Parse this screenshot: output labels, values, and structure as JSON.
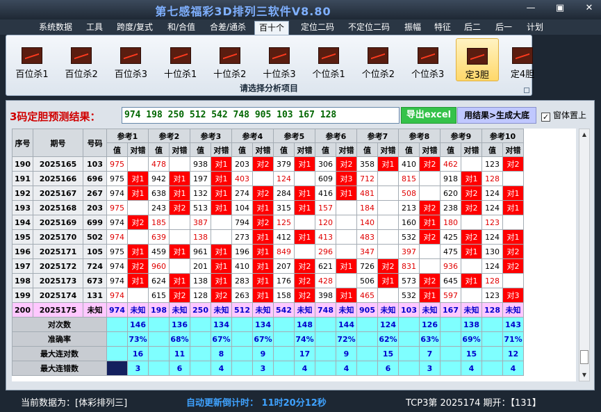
{
  "window": {
    "title": "第七感福彩3D排列三软件V8.80",
    "minimize": "—",
    "restore": "▣",
    "close": "✕"
  },
  "menu": [
    "系统数据",
    "工具",
    "跨度/复式",
    "和/合值",
    "合差/通杀",
    "百十个",
    "定位二码",
    "不定位二码",
    "振幅",
    "特征",
    "后二",
    "后一",
    "计划"
  ],
  "menu_active": "百十个",
  "ribbon": {
    "items": [
      "百位杀1",
      "百位杀2",
      "百位杀3",
      "十位杀1",
      "十位杀2",
      "十位杀3",
      "个位杀1",
      "个位杀2",
      "个位杀3",
      "定3胆",
      "定4胆"
    ],
    "active": "定3胆",
    "footer": "请选择分析项目"
  },
  "prediction": {
    "label": "3码定胆预测结果：",
    "value": "974 198 250 512 542 748 905 103 167 128",
    "export_button": "导出excel",
    "generate_button": "用结果>生成大底",
    "pin_checkbox": "窗体置上",
    "pin_checked": true
  },
  "table": {
    "headers": {
      "index": "序号",
      "period": "期号",
      "number": "号码",
      "value": "值",
      "result": "对错"
    },
    "refs": [
      "参考1",
      "参考2",
      "参考3",
      "参考4",
      "参考5",
      "参考6",
      "参考7",
      "参考8",
      "参考9",
      "参考10"
    ],
    "rows": [
      {
        "idx": "190",
        "period": "2025165",
        "num": "103",
        "cells": [
          [
            "975",
            "",
            "vred"
          ],
          [
            "478",
            "",
            "vred"
          ],
          [
            "938",
            "对1",
            ""
          ],
          [
            "203",
            "对2",
            ""
          ],
          [
            "379",
            "对1",
            ""
          ],
          [
            "306",
            "对2",
            ""
          ],
          [
            "358",
            "对1",
            ""
          ],
          [
            "410",
            "对2",
            ""
          ],
          [
            "462",
            "",
            "vred"
          ],
          [
            "123",
            "对2",
            ""
          ]
        ]
      },
      {
        "idx": "191",
        "period": "2025166",
        "num": "696",
        "cells": [
          [
            "975",
            "对1",
            ""
          ],
          [
            "942",
            "对1",
            ""
          ],
          [
            "197",
            "对1",
            ""
          ],
          [
            "403",
            "",
            "vred"
          ],
          [
            "124",
            "",
            "vred"
          ],
          [
            "609",
            "对3",
            ""
          ],
          [
            "712",
            "",
            "vred"
          ],
          [
            "815",
            "",
            "vred"
          ],
          [
            "918",
            "对1",
            ""
          ],
          [
            "128",
            "",
            "vred"
          ]
        ]
      },
      {
        "idx": "192",
        "period": "2025167",
        "num": "267",
        "cells": [
          [
            "974",
            "对1",
            ""
          ],
          [
            "638",
            "对1",
            ""
          ],
          [
            "132",
            "对1",
            ""
          ],
          [
            "274",
            "对2",
            ""
          ],
          [
            "284",
            "对1",
            ""
          ],
          [
            "416",
            "对1",
            ""
          ],
          [
            "481",
            "",
            "vred"
          ],
          [
            "508",
            "",
            "vred"
          ],
          [
            "620",
            "对2",
            ""
          ],
          [
            "124",
            "对1",
            ""
          ]
        ]
      },
      {
        "idx": "193",
        "period": "2025168",
        "num": "203",
        "cells": [
          [
            "975",
            "",
            "vred"
          ],
          [
            "243",
            "对2",
            ""
          ],
          [
            "513",
            "对1",
            ""
          ],
          [
            "104",
            "对1",
            ""
          ],
          [
            "315",
            "对1",
            ""
          ],
          [
            "157",
            "",
            "vred"
          ],
          [
            "184",
            "",
            "vred"
          ],
          [
            "213",
            "对2",
            ""
          ],
          [
            "238",
            "对2",
            ""
          ],
          [
            "124",
            "对1",
            ""
          ]
        ]
      },
      {
        "idx": "194",
        "period": "2025169",
        "num": "699",
        "cells": [
          [
            "974",
            "对2",
            ""
          ],
          [
            "185",
            "",
            "vred"
          ],
          [
            "387",
            "",
            "vred"
          ],
          [
            "794",
            "对2",
            ""
          ],
          [
            "125",
            "",
            "vred"
          ],
          [
            "120",
            "",
            "vred"
          ],
          [
            "140",
            "",
            "vred"
          ],
          [
            "160",
            "对1",
            ""
          ],
          [
            "180",
            "",
            "vred"
          ],
          [
            "123",
            "",
            "vred"
          ]
        ]
      },
      {
        "idx": "195",
        "period": "2025170",
        "num": "502",
        "cells": [
          [
            "974",
            "",
            "vred"
          ],
          [
            "639",
            "",
            "vred"
          ],
          [
            "138",
            "",
            "vred"
          ],
          [
            "273",
            "对1",
            ""
          ],
          [
            "412",
            "对1",
            ""
          ],
          [
            "413",
            "",
            "vred"
          ],
          [
            "483",
            "",
            "vred"
          ],
          [
            "532",
            "对2",
            ""
          ],
          [
            "425",
            "对2",
            ""
          ],
          [
            "124",
            "对1",
            ""
          ]
        ]
      },
      {
        "idx": "196",
        "period": "2025171",
        "num": "105",
        "cells": [
          [
            "975",
            "对1",
            ""
          ],
          [
            "459",
            "对1",
            ""
          ],
          [
            "961",
            "对1",
            ""
          ],
          [
            "196",
            "对1",
            ""
          ],
          [
            "849",
            "",
            "vred"
          ],
          [
            "296",
            "",
            "vred"
          ],
          [
            "347",
            "",
            "vred"
          ],
          [
            "397",
            "",
            "vred"
          ],
          [
            "475",
            "对1",
            ""
          ],
          [
            "130",
            "对2",
            ""
          ]
        ]
      },
      {
        "idx": "197",
        "period": "2025172",
        "num": "724",
        "cells": [
          [
            "974",
            "对2",
            ""
          ],
          [
            "960",
            "",
            "vred"
          ],
          [
            "201",
            "对1",
            ""
          ],
          [
            "410",
            "对1",
            ""
          ],
          [
            "207",
            "对2",
            ""
          ],
          [
            "621",
            "对1",
            ""
          ],
          [
            "726",
            "对2",
            ""
          ],
          [
            "831",
            "",
            "vred"
          ],
          [
            "936",
            "",
            "vred"
          ],
          [
            "124",
            "对2",
            ""
          ]
        ]
      },
      {
        "idx": "198",
        "period": "2025173",
        "num": "673",
        "cells": [
          [
            "974",
            "对1",
            ""
          ],
          [
            "624",
            "对1",
            ""
          ],
          [
            "138",
            "对1",
            ""
          ],
          [
            "283",
            "对1",
            ""
          ],
          [
            "176",
            "对2",
            ""
          ],
          [
            "428",
            "",
            "vred"
          ],
          [
            "506",
            "对1",
            ""
          ],
          [
            "573",
            "对2",
            ""
          ],
          [
            "645",
            "对1",
            ""
          ],
          [
            "128",
            "",
            "vred"
          ]
        ]
      },
      {
        "idx": "199",
        "period": "2025174",
        "num": "131",
        "cells": [
          [
            "974",
            "",
            "vred"
          ],
          [
            "615",
            "对2",
            ""
          ],
          [
            "128",
            "对2",
            ""
          ],
          [
            "263",
            "对1",
            ""
          ],
          [
            "158",
            "对2",
            ""
          ],
          [
            "398",
            "对1",
            ""
          ],
          [
            "465",
            "",
            "vred"
          ],
          [
            "532",
            "对1",
            ""
          ],
          [
            "597",
            "",
            "vred"
          ],
          [
            "123",
            "对3",
            ""
          ]
        ]
      }
    ],
    "predict_row": {
      "idx": "200",
      "period": "2025175",
      "num": "未知",
      "unknown": "未知",
      "values": [
        "974",
        "198",
        "250",
        "512",
        "542",
        "748",
        "905",
        "103",
        "167",
        "128"
      ]
    },
    "stats": [
      {
        "label": "对次数",
        "values": [
          "146",
          "136",
          "134",
          "134",
          "148",
          "144",
          "124",
          "126",
          "138",
          "143"
        ]
      },
      {
        "label": "准确率",
        "values": [
          "73%",
          "68%",
          "67%",
          "67%",
          "74%",
          "72%",
          "62%",
          "63%",
          "69%",
          "71%"
        ]
      },
      {
        "label": "最大连对数",
        "values": [
          "16",
          "11",
          "8",
          "9",
          "17",
          "9",
          "15",
          "7",
          "15",
          "12"
        ]
      },
      {
        "label": "最大连错数",
        "values": [
          "3",
          "6",
          "4",
          "3",
          "4",
          "4",
          "6",
          "3",
          "4",
          "4"
        ]
      }
    ]
  },
  "status": {
    "current_data": "当前数据为：[体彩排列三]",
    "countdown": "自动更新倒计时： 11时20分12秒",
    "draw_info": "TCP3第 2025174 期开：【131】"
  },
  "colors": {
    "hit": "#ff0000",
    "predict_row": "#ffc8ff",
    "stats_row": "#7fffff",
    "export_button": "#35c24a"
  }
}
